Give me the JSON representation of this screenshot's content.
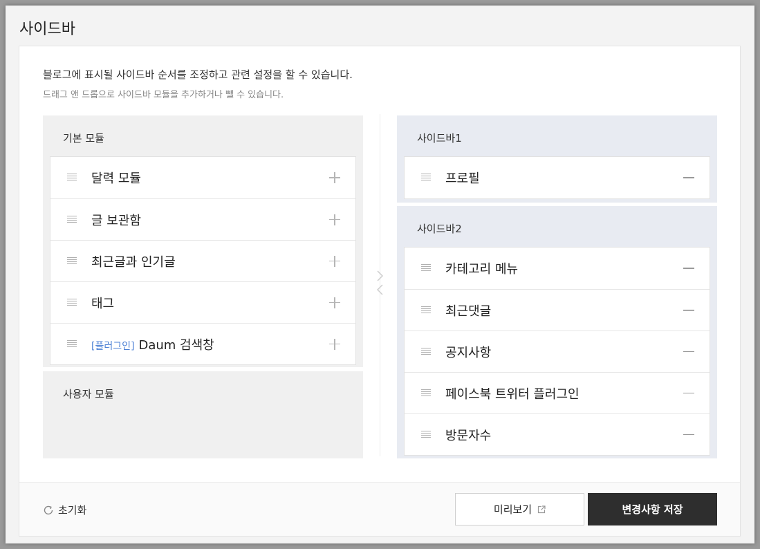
{
  "page": {
    "title": "사이드바",
    "description": "블로그에 표시될 사이드바 순서를 조정하고 관련 설정을 할 수 있습니다.",
    "sub_description": "드래그 앤 드롭으로 사이드바 모듈을 추가하거나 뺄 수 있습니다."
  },
  "basic_modules": {
    "title": "기본 모듈",
    "items": [
      {
        "label": "달력 모듈",
        "tag": ""
      },
      {
        "label": "글 보관함",
        "tag": ""
      },
      {
        "label": "최근글과 인기글",
        "tag": ""
      },
      {
        "label": "태그",
        "tag": ""
      },
      {
        "label": "Daum 검색창",
        "tag": "[플러그인]"
      }
    ]
  },
  "user_modules": {
    "title": "사용자 모듈"
  },
  "sidebar1": {
    "title": "사이드바1",
    "items": [
      {
        "label": "프로필"
      }
    ]
  },
  "sidebar2": {
    "title": "사이드바2",
    "items": [
      {
        "label": "카테고리 메뉴"
      },
      {
        "label": "최근댓글"
      },
      {
        "label": "공지사항"
      },
      {
        "label": "페이스북 트위터 플러그인"
      },
      {
        "label": "방문자수"
      }
    ]
  },
  "footer": {
    "reset_label": "초기화",
    "preview_label": "미리보기",
    "save_label": "변경사항 저장"
  },
  "icons": {
    "drag": "drag-handle-icon",
    "add": "plus-icon",
    "remove": "minus-icon",
    "reset": "refresh-icon",
    "external": "external-link-icon",
    "move": "arrow-left-right-icon"
  },
  "colors": {
    "tag": "#4a7fd4",
    "save_button": "#2e2e2e",
    "sidebar_group_bg": "#e8ebf2",
    "module_group_bg": "#f0f0f0"
  }
}
